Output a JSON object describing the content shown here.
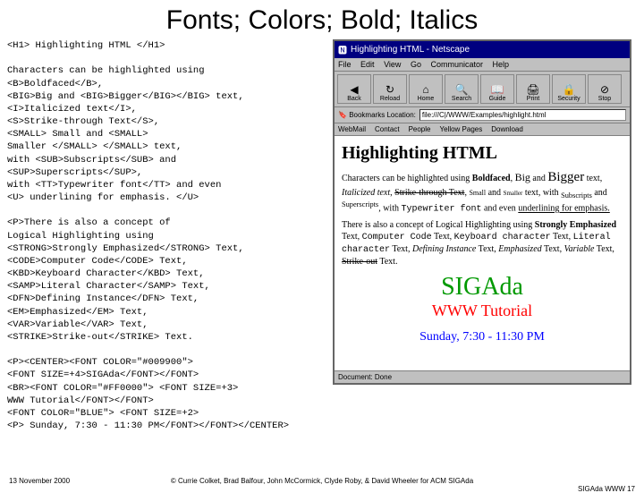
{
  "title": "Fonts; Colors; Bold; Italics",
  "code": "<H1> Highlighting HTML </H1>\n\nCharacters can be highlighted using\n<B>Boldfaced</B>,\n<BIG>Big and <BIG>Bigger</BIG></BIG> text,\n<I>Italicized text</I>,\n<S>Strike-through Text</S>,\n<SMALL> Small and <SMALL>\nSmaller </SMALL> </SMALL> text,\nwith <SUB>Subscripts</SUB> and\n<SUP>Superscripts</SUP>,\nwith <TT>Typewriter font</TT> and even\n<U> underlining for emphasis. </U>\n\n<P>There is also a concept of\nLogical Highlighting using\n<STRONG>Strongly Emphasized</STRONG> Text,\n<CODE>Computer Code</CODE> Text,\n<KBD>Keyboard Character</KBD> Text,\n<SAMP>Literal Character</SAMP> Text,\n<DFN>Defining Instance</DFN> Text,\n<EM>Emphasized</EM> Text,\n<VAR>Variable</VAR> Text,\n<STRIKE>Strike-out</STRIKE> Text.\n\n<P><CENTER><FONT COLOR=\"#009900\">\n<FONT SIZE=+4>SIGAda</FONT></FONT>\n<BR><FONT COLOR=\"#FF0000\"> <FONT SIZE=+3>\nWWW Tutorial</FONT></FONT>\n<FONT COLOR=\"BLUE\"> <FONT SIZE=+2>\n<P> Sunday, 7:30 - 11:30 PM</FONT></FONT></CENTER>",
  "browser": {
    "title": "Highlighting HTML - Netscape",
    "menu": [
      "File",
      "Edit",
      "View",
      "Go",
      "Communicator",
      "Help"
    ],
    "tools": [
      {
        "label": "Back",
        "ico": "◀"
      },
      {
        "label": "Reload",
        "ico": "↻"
      },
      {
        "label": "Home",
        "ico": "⌂"
      },
      {
        "label": "Search",
        "ico": "🔍"
      },
      {
        "label": "Guide",
        "ico": "📖"
      },
      {
        "label": "Print",
        "ico": "🖨"
      },
      {
        "label": "Security",
        "ico": "🔒"
      },
      {
        "label": "Stop",
        "ico": "⊘"
      }
    ],
    "bookmarks_label": "Bookmarks",
    "location_label": "Location:",
    "url": "file:///C|/WWW/Examples/highlight.html",
    "links": [
      "WebMail",
      "Contact",
      "People",
      "Yellow Pages",
      "Download"
    ],
    "page": {
      "h1": "Highlighting HTML",
      "p1_a": "Characters can be highlighted using ",
      "p1_bold": "Boldfaced",
      "p1_b": ", ",
      "p1_big": "Big",
      "p1_and": " and ",
      "p1_bigger": "Bigger",
      "p1_c": " text, ",
      "p1_ital": "Italicized text",
      "p1_d": ", ",
      "p1_strike": "Strike-through Text",
      "p1_e": ", ",
      "p1_small": "Small",
      "p1_smaller": "Smaller",
      "p1_f": " text, with ",
      "p1_sub": "Subscripts",
      "p1_g": " and ",
      "p1_sup": "Superscripts",
      "p1_h": ", with ",
      "p1_tt": "Typewriter font",
      "p1_i": " and even ",
      "p1_u": "underlining for emphasis.",
      "p2_a": "There is also a concept of Logical Highlighting using ",
      "p2_strong": "Strongly Emphasized",
      "p2_b": " Text, ",
      "p2_code": "Computer Code",
      "p2_c": " Text, ",
      "p2_kbd": "Keyboard character",
      "p2_d": " Text, ",
      "p2_samp": "Literal character",
      "p2_e": " Text, ",
      "p2_dfn": "Defining Instance",
      "p2_f": " Text, ",
      "p2_em": "Emphasized",
      "p2_g": " Text, ",
      "p2_var": "Variable",
      "p2_h": " Text, ",
      "p2_strikeout": "Strike-out",
      "p2_i": " Text.",
      "sigada": "SIGAda",
      "tutorial": "WWW Tutorial",
      "sunday": "Sunday, 7:30 - 11:30 PM"
    },
    "status": "Document: Done"
  },
  "footer": {
    "date": "13 November 2000",
    "center": "© Currie Colket, Brad Balfour, John McCormick, Clyde Roby, & David Wheeler for ACM SIGAda",
    "right": "SIGAda WWW 17"
  }
}
